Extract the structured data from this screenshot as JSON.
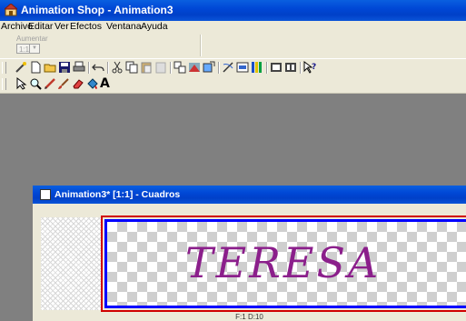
{
  "app": {
    "title": "Animation Shop - Animation3"
  },
  "menu": [
    "Archivo",
    "Editar",
    "Ver",
    "Efectos",
    "Ventana",
    "Ayuda"
  ],
  "zoombar": {
    "label": "Aumentar",
    "value": "1:1"
  },
  "toolbar_main": [
    "wizard-icon",
    "new-icon",
    "open-icon",
    "save-icon",
    "print-icon",
    "undo-icon",
    "cut-icon",
    "copy-icon",
    "paste-icon",
    "paste-disabled-icon",
    "transition-icon",
    "effects-icon",
    "resize-icon",
    "optimize-icon",
    "view-animation-icon",
    "color-palette-icon",
    "frame-properties-icon",
    "animation-properties-icon",
    "help-icon"
  ],
  "toolbar_tools": [
    "select-arrow-icon",
    "zoom-icon",
    "pencil-icon",
    "brush-icon",
    "eraser-icon",
    "fill-icon",
    "text-icon"
  ],
  "text_tool_glyph": "A",
  "child_window": {
    "title": "Animation3* [1:1] - Cuadros",
    "frame_text": "TERESA",
    "status": "F:1  D:10"
  },
  "colors": {
    "titlebar": "#0048d6",
    "chrome": "#ece9d8",
    "workspace": "#808080",
    "frame_text": "#8b1f8b",
    "selected_frame_border": "#0000ff",
    "current_frame_border": "#d00000"
  }
}
